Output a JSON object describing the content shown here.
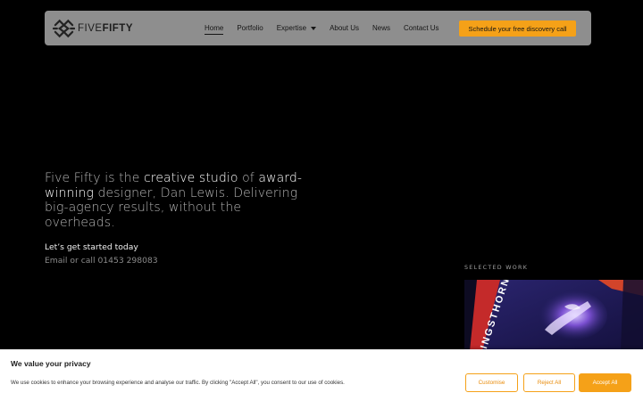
{
  "brand": {
    "logo_text_light": "FIVE",
    "logo_text_bold": "FIFTY"
  },
  "nav": {
    "items": [
      {
        "label": "Home",
        "active": true
      },
      {
        "label": "Portfolio"
      },
      {
        "label": "Expertise",
        "has_dropdown": true
      },
      {
        "label": "About Us"
      },
      {
        "label": "News"
      },
      {
        "label": "Contact Us"
      }
    ],
    "cta_label": "Schedule your free discovery call"
  },
  "hero": {
    "p1": "Five Fifty is the ",
    "h1": "creative studio",
    "p2": " of ",
    "h2": "award-winning",
    "p3": " designer, Dan Lewis. Delivering big-agency results, without the overheads.",
    "cta_title": "Let’s get started today",
    "contact_prefix": "Email or call ",
    "phone": "01453 298083"
  },
  "work": {
    "section_label": "SELECTED WORK"
  },
  "cookie": {
    "title": "We value your privacy",
    "message": "We use cookies to enhance your browsing experience and analyse our traffic. By clicking \"Accept All\", you consent to our use of cookies.",
    "customise": "Customise",
    "reject": "Reject All",
    "accept": "Accept All"
  },
  "colors": {
    "background": "#000000",
    "navbar": "#8e8e8e",
    "accent": "#f5a118",
    "text_highlight": "#ffffff",
    "text_muted": "#b3b3b3"
  },
  "icons": {
    "logo": "five-fifty-logo-icon",
    "dropdown": "chevron-down-icon"
  }
}
